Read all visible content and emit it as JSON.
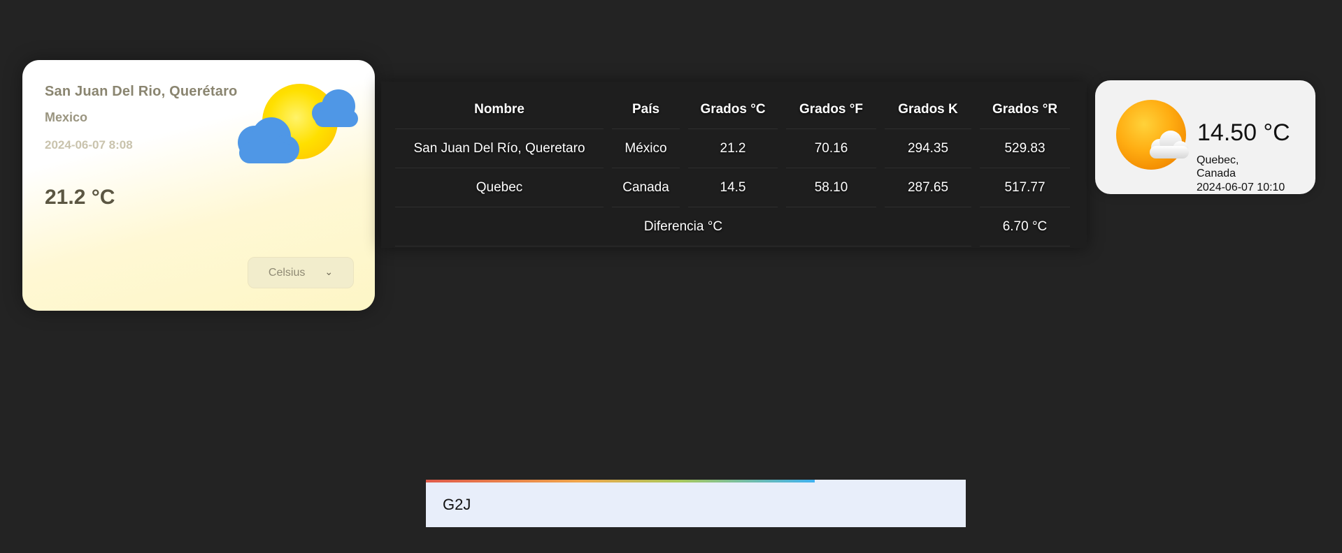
{
  "left_card": {
    "city": "San Juan Del Rio, Querétaro",
    "country": "Mexico",
    "datetime": "2024-06-07 8:08",
    "temperature": "21.2 °C",
    "weather_icon": "sun-behind-clouds-icon",
    "unit_select": {
      "selected": "Celsius"
    }
  },
  "table": {
    "headers": [
      "Nombre",
      "País",
      "Grados °C",
      "Grados °F",
      "Grados K",
      "Grados °R"
    ],
    "rows": [
      [
        "San Juan Del Río, Queretaro",
        "México",
        "21.2",
        "70.16",
        "294.35",
        "529.83"
      ],
      [
        "Quebec",
        "Canada",
        "14.5",
        "58.10",
        "287.65",
        "517.77"
      ]
    ],
    "difference": {
      "label": "Diferencia °C",
      "value": "6.70 °C"
    }
  },
  "right_card": {
    "temperature": "14.50 °C",
    "city": "Quebec,",
    "country": "Canada",
    "datetime": "2024-06-07 10:10",
    "weather_icon": "sun-behind-cloud-icon"
  },
  "postal_input": {
    "value": "G2J",
    "progress": 0.72
  },
  "colors": {
    "background": "#232323",
    "sun": "#ffd800",
    "cloud_blue": "#4f97e6",
    "input_bg": "#e8eefa"
  }
}
